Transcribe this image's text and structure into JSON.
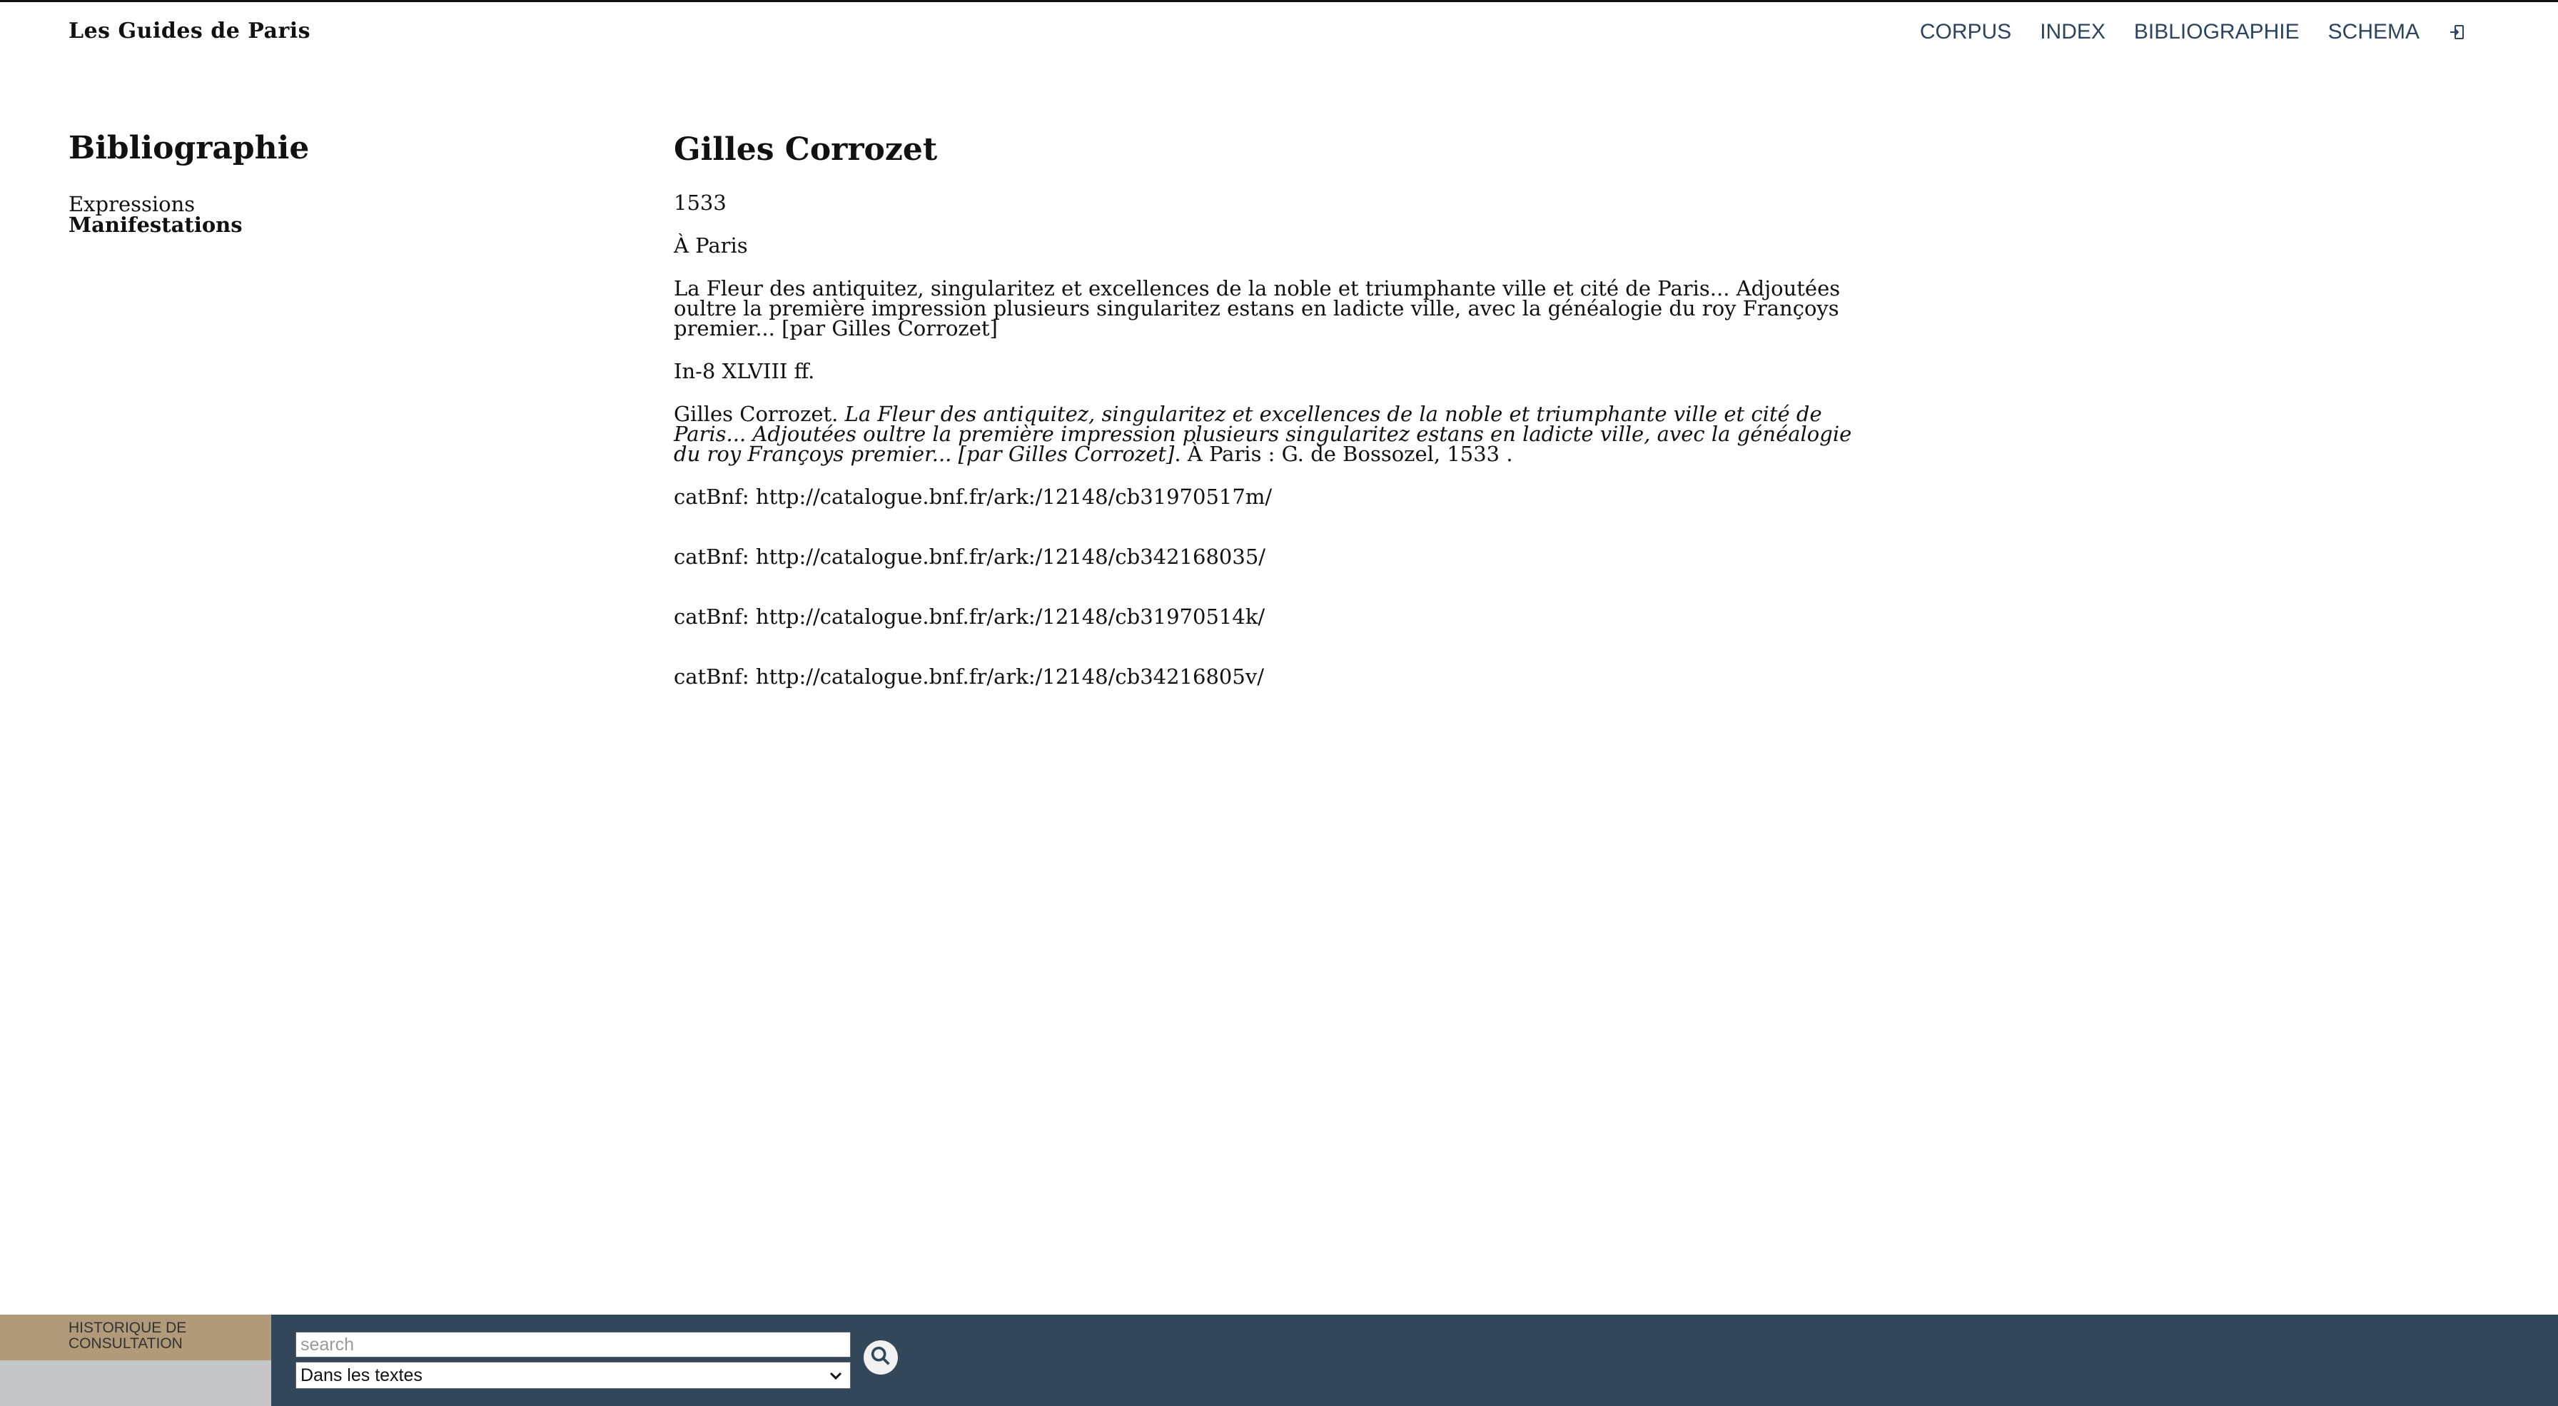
{
  "header": {
    "brand": "Les Guides de Paris",
    "nav": [
      "CORPUS",
      "INDEX",
      "BIBLIOGRAPHIE",
      "SCHEMA"
    ],
    "login_icon": "sign-in-icon"
  },
  "sidebar": {
    "title": "Bibliographie",
    "links": [
      {
        "label": "Expressions",
        "active": false
      },
      {
        "label": "Manifestations",
        "active": true
      }
    ]
  },
  "main": {
    "title": "Gilles Corrozet",
    "year": "1533",
    "place": "À Paris",
    "full_title": "La Fleur des antiquitez, singularitez et excellences de la noble et triumphante ville et cité de Paris... Adjoutées oultre la première impression plusieurs singularitez estans en ladicte ville, avec la généalogie du roy Françoys premier... [par Gilles Corrozet]",
    "format": "In-8 XLVIII ff.",
    "citation": {
      "author": "Gilles Corrozet. ",
      "title": "La Fleur des antiquitez, singularitez et excellences de la noble et triumphante ville et cité de Paris... Adjoutées oultre la première impression plusieurs singularitez estans en ladicte ville, avec la généalogie du roy Françoys premier... [par Gilles Corrozet]",
      "imprint": ". À Paris : G. de Bossozel, 1533 ."
    },
    "catalog_links": [
      "catBnf: http://catalogue.bnf.fr/ark:/12148/cb31970517m/",
      "catBnf: http://catalogue.bnf.fr/ark:/12148/cb342168035/",
      "catBnf: http://catalogue.bnf.fr/ark:/12148/cb31970514k/",
      "catBnf: http://catalogue.bnf.fr/ark:/12148/cb34216805v/"
    ]
  },
  "footer": {
    "history_label": "HISTORIQUE DE CONSULTATION",
    "search_placeholder": "search",
    "search_value": "",
    "scope_selected": "Dans les textes",
    "search_icon": "search-icon"
  },
  "colors": {
    "footer_bg": "#33475b",
    "history_tab": "#b09a79",
    "history_bg": "#c3c5c6",
    "nav_text": "#2c4460"
  }
}
